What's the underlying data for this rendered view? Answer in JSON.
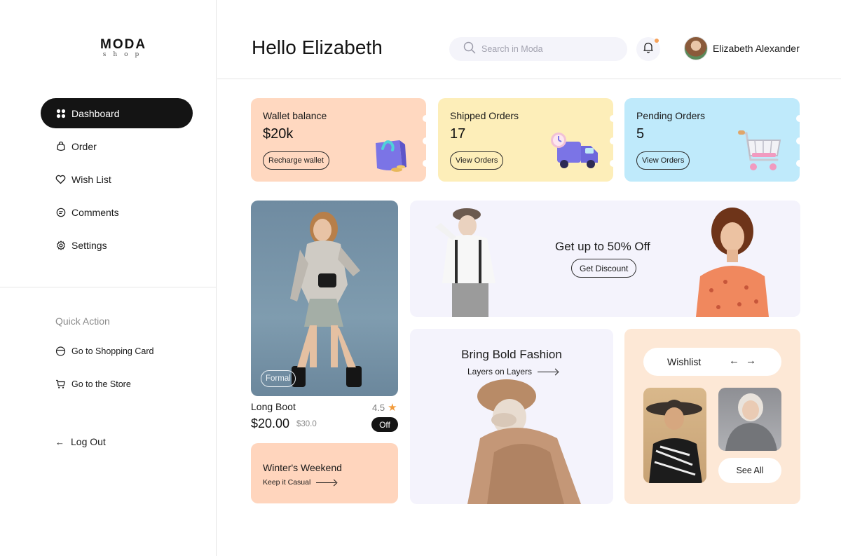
{
  "brand": {
    "name": "MODA",
    "sub": "shop"
  },
  "nav": {
    "items": [
      {
        "label": "Dashboard",
        "icon": "grid-icon",
        "active": true
      },
      {
        "label": "Order",
        "icon": "bag-icon"
      },
      {
        "label": "Wish List",
        "icon": "heart-icon"
      },
      {
        "label": "Comments",
        "icon": "chat-icon"
      },
      {
        "label": "Settings",
        "icon": "gear-icon"
      }
    ]
  },
  "quick_action": {
    "title": "Quick Action",
    "items": [
      {
        "label": "Go to Shopping Card",
        "icon": "card-icon"
      },
      {
        "label": "Go to the Store",
        "icon": "cart-icon"
      }
    ]
  },
  "logout": {
    "label": "Log Out",
    "icon": "arrow-left-icon"
  },
  "header": {
    "greeting": "Hello Elizabeth",
    "search_placeholder": "Search in Moda",
    "user_name": "Elizabeth Alexander"
  },
  "stats": [
    {
      "label": "Wallet balance",
      "value": "$20k",
      "button": "Recharge wallet",
      "color": "#ffd8c0"
    },
    {
      "label": "Shipped Orders",
      "value": "17",
      "button": "View Orders",
      "color": "#fdeeb9"
    },
    {
      "label": "Pending Orders",
      "value": "5",
      "button": "View Orders",
      "color": "#bfeafb"
    }
  ],
  "product": {
    "tag": "Formal",
    "name": "Long Boot",
    "rating": "4.5",
    "price": "$20.00",
    "old_price": "$30.0",
    "badge": "Off"
  },
  "winter": {
    "title": "Winter's Weekend",
    "subtitle": "Keep it Casual"
  },
  "promo": {
    "title": "Get up to 50% Off",
    "button": "Get Discount"
  },
  "bold": {
    "title": "Bring Bold Fashion",
    "subtitle": "Layers on Layers"
  },
  "wishlist": {
    "title": "Wishlist",
    "prev": "←",
    "next": "→",
    "see_all": "See All"
  },
  "colors": {
    "accent_dark": "#141414",
    "star": "#f29b3b",
    "notification": "#f6a25a"
  }
}
